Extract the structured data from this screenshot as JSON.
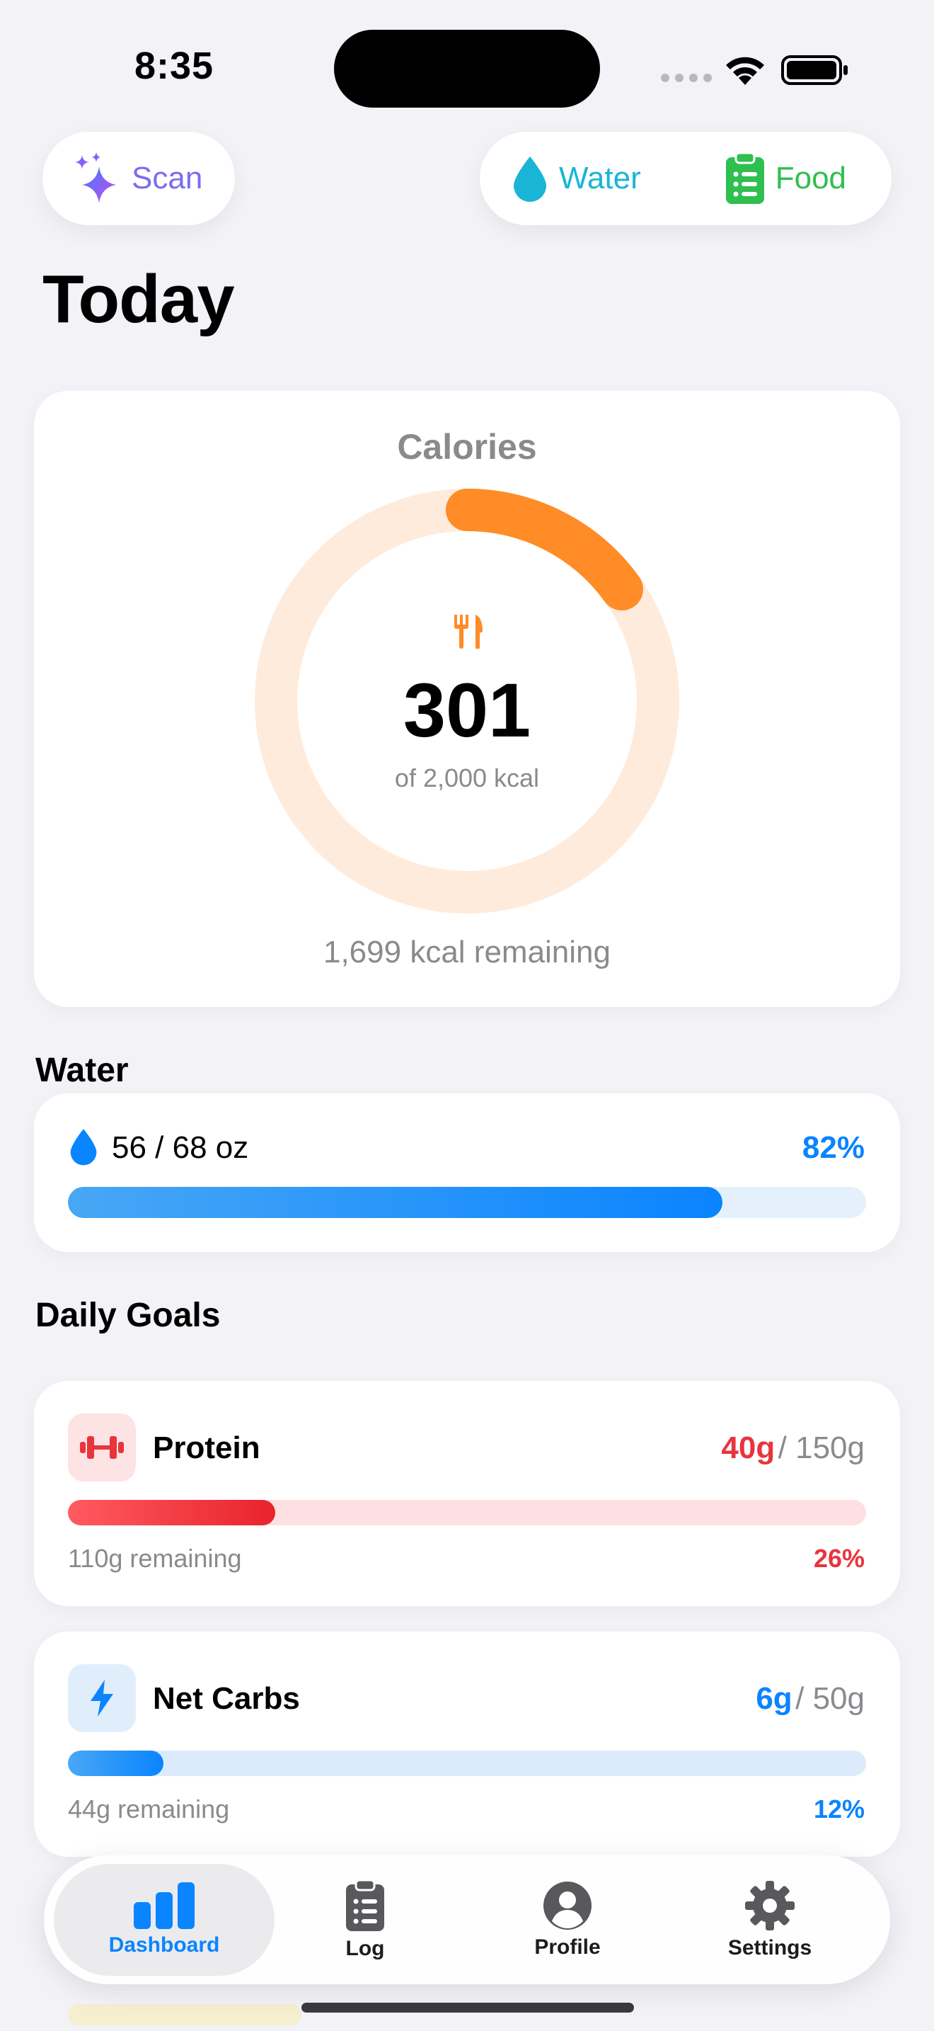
{
  "status_bar": {
    "time": "8:35"
  },
  "top_actions": {
    "scan_label": "Scan",
    "water_label": "Water",
    "food_label": "Food"
  },
  "page": {
    "title": "Today"
  },
  "calories": {
    "title": "Calories",
    "consumed": "301",
    "goal_text": "of 2,000 kcal",
    "remaining_text": "1,699 kcal remaining",
    "progress_fraction": 0.1505,
    "colors": {
      "ring": "#ff8c26",
      "track": "#ffebdb"
    }
  },
  "water": {
    "section_title": "Water",
    "amount_text": "56 / 68 oz",
    "percent_text": "82%",
    "progress_fraction": 0.82,
    "colors": {
      "accent": "#0a84ff",
      "track": "#e4f1fc"
    }
  },
  "daily_goals": {
    "section_title": "Daily Goals",
    "items": [
      {
        "name": "Protein",
        "icon": "dumbbell-icon",
        "current": "40g",
        "goal": "/ 150g",
        "remaining": "110g remaining",
        "percent": "26%",
        "progress_fraction": 0.26,
        "colors": {
          "accent": "#e8343d",
          "track": "#fde0e2",
          "icon_bg": "#fde3e4"
        }
      },
      {
        "name": "Net Carbs",
        "icon": "bolt-icon",
        "current": "6g",
        "goal": "/ 50g",
        "remaining": "44g remaining",
        "percent": "12%",
        "progress_fraction": 0.12,
        "colors": {
          "accent": "#0a84ff",
          "track": "#dcebfb",
          "icon_bg": "#e0eefc"
        }
      }
    ]
  },
  "tab_bar": {
    "tabs": [
      {
        "label": "Dashboard",
        "icon": "chart-bar-icon",
        "active": true
      },
      {
        "label": "Log",
        "icon": "clipboard-list-icon",
        "active": false
      },
      {
        "label": "Profile",
        "icon": "person-circle-icon",
        "active": false
      },
      {
        "label": "Settings",
        "icon": "gear-icon",
        "active": false
      }
    ],
    "colors": {
      "active": "#0a84ff",
      "inactive": "#58585d"
    }
  }
}
